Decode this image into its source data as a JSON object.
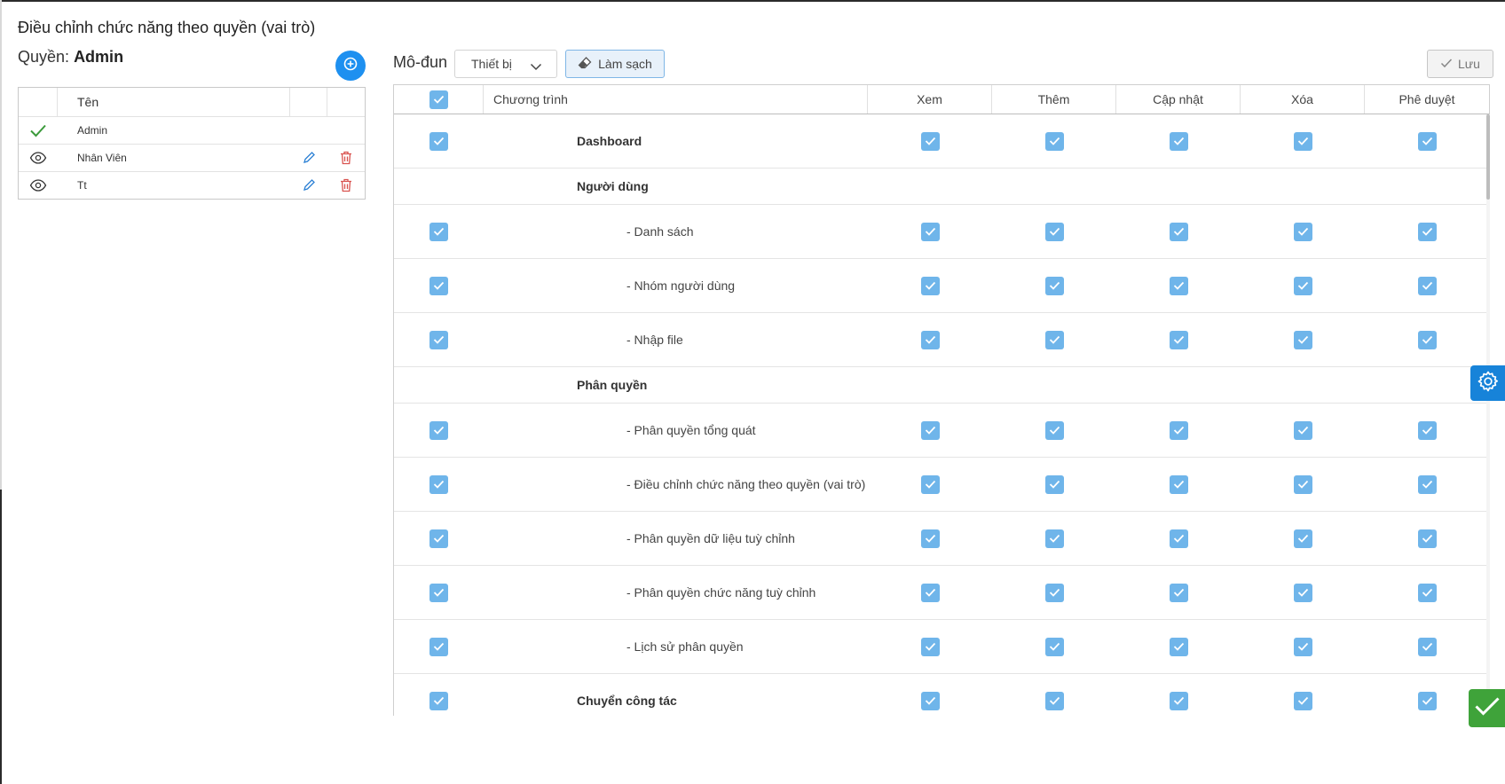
{
  "page": {
    "title": "Điều chỉnh chức năng theo quyền (vai trò)"
  },
  "role_panel": {
    "label": "Quyền:",
    "selected_role": "Admin",
    "add_icon": "plus-circle-icon",
    "header": {
      "name": "Tên"
    },
    "roles": [
      {
        "name": "Admin",
        "status_icon": "check-icon",
        "editable": false
      },
      {
        "name": "Nhân Viên",
        "status_icon": "eye-icon",
        "editable": true
      },
      {
        "name": "Tt",
        "status_icon": "eye-icon",
        "editable": true
      }
    ]
  },
  "toolbar": {
    "module_label": "Mô-đun",
    "module_value": "Thiết bị",
    "clear_label": "Làm sạch",
    "save_label": "Lưu"
  },
  "table": {
    "headers": {
      "program": "Chương trình",
      "view": "Xem",
      "add": "Thêm",
      "update": "Cập nhật",
      "delete": "Xóa",
      "approve": "Phê duyệt"
    },
    "rows": [
      {
        "label": "Dashboard",
        "type": "top",
        "checked": true
      },
      {
        "label": "Người dùng",
        "type": "group"
      },
      {
        "label": "- Danh sách",
        "type": "item",
        "checked": true
      },
      {
        "label": "- Nhóm người dùng",
        "type": "item",
        "checked": true
      },
      {
        "label": "- Nhập file",
        "type": "item",
        "checked": true
      },
      {
        "label": "Phân quyền",
        "type": "group"
      },
      {
        "label": "- Phân quyền tổng quát",
        "type": "item",
        "checked": true
      },
      {
        "label": "- Điều chỉnh chức năng theo quyền (vai trò)",
        "type": "item",
        "checked": true
      },
      {
        "label": "- Phân quyền dữ liệu tuỳ chỉnh",
        "type": "item",
        "checked": true
      },
      {
        "label": "- Phân quyền chức năng tuỳ chỉnh",
        "type": "item",
        "checked": true
      },
      {
        "label": "- Lịch sử phân quyền",
        "type": "item",
        "checked": true
      },
      {
        "label": "Chuyển công tác",
        "type": "top",
        "checked": true
      }
    ]
  },
  "colors": {
    "accent": "#1e90f0",
    "checkbox": "#6fb5ea",
    "delete": "#d9534f",
    "success": "#3fa33a"
  }
}
